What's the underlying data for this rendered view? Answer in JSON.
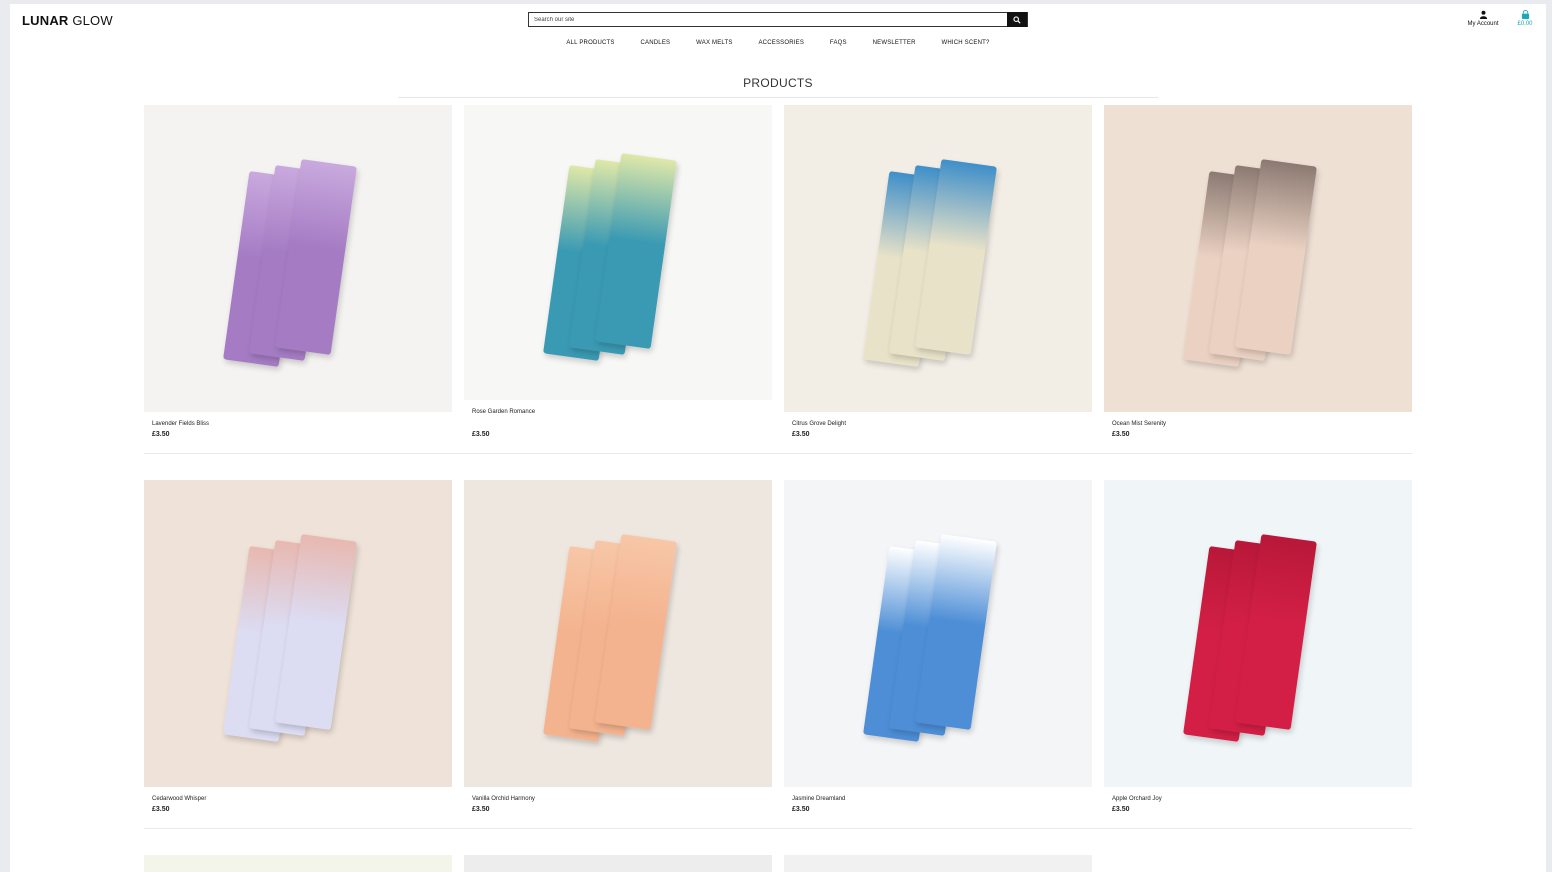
{
  "header": {
    "logo_bold": "LUNAR",
    "logo_regular": "GLOW",
    "search_placeholder": "Search our site",
    "account_label": "My Account",
    "cart_total": "£0.00"
  },
  "nav": [
    "ALL PRODUCTS",
    "CANDLES",
    "WAX MELTS",
    "ACCESSORIES",
    "FAQS",
    "NEWSLETTER",
    "WHICH SCENT?"
  ],
  "page_title": "PRODUCTS",
  "products": [
    {
      "name": "Lavender Fields Bliss",
      "price": "£3.50",
      "bg": "#f4f3f1",
      "bar": "#a57cc4",
      "accent": "#c9a9de"
    },
    {
      "name": "Rose Garden Romance",
      "price": "£3.50",
      "bg": "#f7f7f6",
      "bar": "#3a9ab3",
      "accent": "#dfe8a8"
    },
    {
      "name": "Citrus Grove Delight",
      "price": "£3.50",
      "bg": "#f2eee6",
      "bar": "#e8e2c8",
      "accent": "#3f8fc9"
    },
    {
      "name": "Ocean Mist Serenity",
      "price": "£3.50",
      "bg": "#efe0d4",
      "bar": "#ead1c2",
      "accent": "#8c7a72"
    },
    {
      "name": "Cedarwood Whisper",
      "price": "£3.50",
      "bg": "#efe2d8",
      "bar": "#dcdcf3",
      "accent": "#e8b8b0"
    },
    {
      "name": "Vanilla Orchid Harmony",
      "price": "£3.50",
      "bg": "#eee7e0",
      "bar": "#f4b38f",
      "accent": "#f7c7a7"
    },
    {
      "name": "Jasmine Dreamland",
      "price": "£3.50",
      "bg": "#f4f5f7",
      "bar": "#4d8ed6",
      "accent": "#ffffff"
    },
    {
      "name": "Apple Orchard Joy",
      "price": "£3.50",
      "bg": "#f0f6f8",
      "bar": "#d31f45",
      "accent": "#b81839"
    }
  ]
}
